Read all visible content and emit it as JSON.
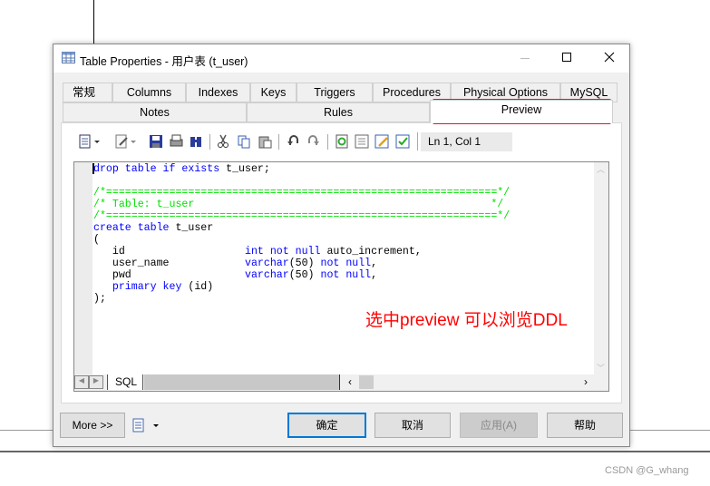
{
  "window": {
    "title": "Table Properties - 用户表 (t_user)",
    "controls": [
      "minimize",
      "maximize",
      "close"
    ]
  },
  "tabs_row1": [
    "常规",
    "Columns",
    "Indexes",
    "Keys",
    "Triggers",
    "Procedures",
    "Physical Options",
    "MySQL"
  ],
  "tabs_row2": [
    "Notes",
    "Rules",
    "Preview"
  ],
  "active_tab": "Preview",
  "toolbar": {
    "status": "Ln 1, Col 1",
    "icons": [
      "preview-options-icon",
      "edit-icon",
      "save-icon",
      "print-icon",
      "find-icon",
      "cut-icon",
      "copy-icon",
      "paste-icon",
      "undo-icon",
      "redo-icon",
      "refresh-icon",
      "list-icon",
      "edit-properties-icon",
      "check-icon"
    ]
  },
  "code": {
    "lines": [
      [
        [
          "kw",
          "drop table if exists"
        ],
        [
          "",
          "t_user;"
        ]
      ],
      [],
      [
        [
          "cm",
          "/*==============================================================*/"
        ]
      ],
      [
        [
          "cm",
          "/* Table: t_user                                               */"
        ]
      ],
      [
        [
          "cm",
          "/*==============================================================*/"
        ]
      ],
      [
        [
          "kw",
          "create table"
        ],
        [
          "",
          "t_user"
        ]
      ],
      [
        [
          "",
          "("
        ]
      ],
      [
        [
          "",
          "   id                   "
        ],
        [
          "kw",
          "int not null"
        ],
        [
          "",
          " auto_increment,"
        ]
      ],
      [
        [
          "",
          "   user_name            "
        ],
        [
          "kw",
          "varchar"
        ],
        [
          "",
          "(50) "
        ],
        [
          "kw",
          "not null"
        ],
        [
          "",
          ","
        ]
      ],
      [
        [
          "",
          "   pwd                  "
        ],
        [
          "kw",
          "varchar"
        ],
        [
          "",
          "(50) "
        ],
        [
          "kw",
          "not null"
        ],
        [
          "",
          ","
        ]
      ],
      [
        [
          "",
          "   "
        ],
        [
          "kw",
          "primary key"
        ],
        [
          "",
          " (id)"
        ]
      ],
      [
        [
          "",
          ");"
        ]
      ]
    ]
  },
  "sheet_tab": "SQL",
  "annotation": "选中preview 可以浏览DDL",
  "buttons": {
    "more": "More >>",
    "ok": "确定",
    "cancel": "取消",
    "apply": "应用(A)",
    "help": "帮助"
  },
  "watermark": "CSDN @G_whang",
  "colors": {
    "keyword": "#0000ff",
    "comment": "#00e000",
    "highlight": "#e81123",
    "annotation": "#ff0000",
    "default_button": "#0078d7"
  }
}
